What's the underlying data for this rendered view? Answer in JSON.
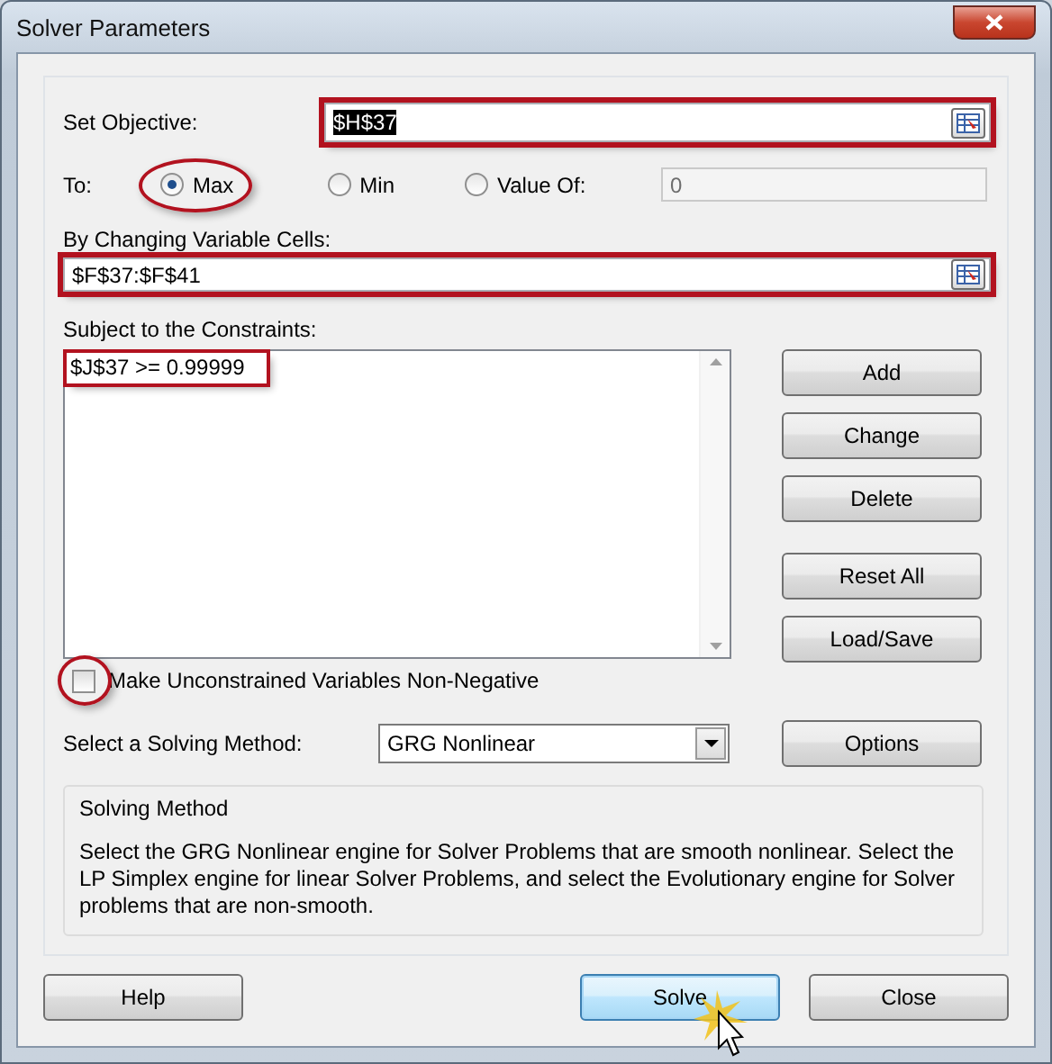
{
  "window": {
    "title": "Solver Parameters"
  },
  "objective": {
    "label": "Set Objective:",
    "value": "$H$37",
    "value_selected": true,
    "highlighted": true
  },
  "to": {
    "label": "To:",
    "options": [
      {
        "label": "Max",
        "selected": true,
        "highlighted": true
      },
      {
        "label": "Min",
        "selected": false,
        "highlighted": false
      },
      {
        "label": "Value Of:",
        "selected": false,
        "highlighted": false
      }
    ],
    "value_of": {
      "value": "0",
      "disabled": true
    }
  },
  "variable_cells": {
    "label": "By Changing Variable Cells:",
    "value": "$F$37:$F$41",
    "highlighted": true
  },
  "constraints": {
    "label": "Subject to the Constraints:",
    "items": [
      {
        "text": "$J$37 >= 0.99999",
        "highlighted": true
      }
    ]
  },
  "constraint_buttons": [
    "Add",
    "Change",
    "Delete",
    "Reset All",
    "Load/Save"
  ],
  "non_negative": {
    "label": "Make Unconstrained Variables Non-Negative",
    "checked": false,
    "highlighted": true
  },
  "method": {
    "label": "Select a Solving Method:",
    "value": "GRG Nonlinear",
    "options_button": "Options"
  },
  "method_info": {
    "title": "Solving Method",
    "text": "Select the GRG Nonlinear engine for Solver Problems that are smooth nonlinear. Select the LP Simplex engine for linear Solver Problems, and select the Evolutionary engine for Solver problems that are non-smooth."
  },
  "footer_buttons": [
    {
      "label": "Help",
      "focused": false,
      "clicked": false
    },
    {
      "label": "Solve",
      "focused": true,
      "clicked": true
    },
    {
      "label": "Close",
      "focused": false,
      "clicked": false
    }
  ]
}
